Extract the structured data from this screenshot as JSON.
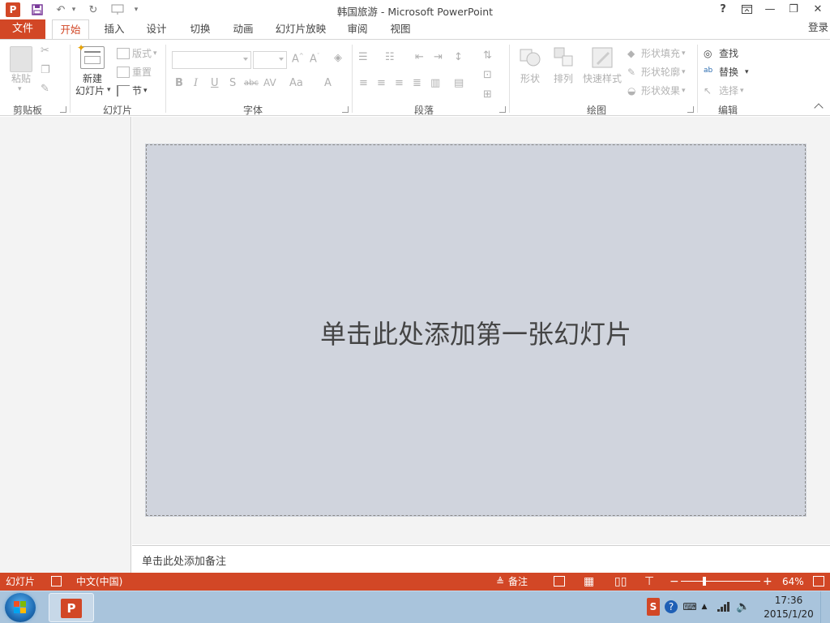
{
  "window": {
    "title": "韩国旅游 - Microsoft PowerPoint",
    "help": "?",
    "close": "✕",
    "minimize": "—",
    "restore": "❐"
  },
  "tabs": {
    "file": "文件",
    "items": [
      "开始",
      "插入",
      "设计",
      "切换",
      "动画",
      "幻灯片放映",
      "审阅",
      "视图"
    ],
    "active": "开始",
    "login": "登录"
  },
  "ribbon": {
    "clipboard": {
      "label": "剪贴板",
      "paste": "粘贴"
    },
    "slides": {
      "label": "幻灯片",
      "new_slide_1": "新建",
      "new_slide_2": "幻灯片",
      "layout": "版式",
      "reset": "重置",
      "section": "节"
    },
    "font": {
      "label": "字体",
      "bold": "B",
      "italic": "I",
      "underline": "U",
      "shadow": "S",
      "strike": "abc",
      "spacing": "AV",
      "case": "Aa",
      "color": "A"
    },
    "paragraph": {
      "label": "段落"
    },
    "drawing": {
      "label": "绘图",
      "shapes": "形状",
      "arrange": "排列",
      "quick_styles": "快速样式",
      "fill": "形状填充",
      "outline": "形状轮廓",
      "effects": "形状效果"
    },
    "editing": {
      "label": "编辑",
      "find": "查找",
      "replace": "替换",
      "select": "选择"
    }
  },
  "slide": {
    "placeholder": "单击此处添加第一张幻灯片"
  },
  "notes": {
    "placeholder": "单击此处添加备注"
  },
  "statusbar": {
    "slide": "幻灯片",
    "language": "中文(中国)",
    "notes": "备注",
    "zoom_out": "−",
    "zoom_in": "+",
    "zoom_level": "64%",
    "zoom_value": 64
  },
  "taskbar": {
    "time": "17:36",
    "date": "2015/1/20"
  },
  "colors": {
    "accent": "#d24726",
    "slide_bg": "#d0d4dd",
    "taskbar": "#a9c4dc"
  }
}
